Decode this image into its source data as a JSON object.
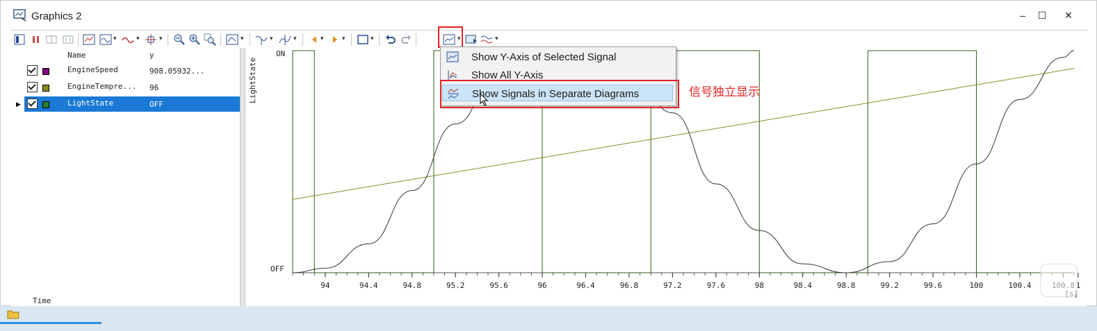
{
  "window": {
    "title": "Graphics 2",
    "min": "–",
    "max": "☐",
    "close": "✕"
  },
  "signals": {
    "headers": {
      "name": "Name",
      "y": "y"
    },
    "rows": [
      {
        "name": "EngineSpeed",
        "value": "908.05932...",
        "color": "#800080"
      },
      {
        "name": "EngineTempre...",
        "value": "96",
        "color": "#8a8a20"
      },
      {
        "name": "LightState",
        "value": "OFF",
        "color": "#2e7d32"
      }
    ],
    "time_label": "Time"
  },
  "menu": {
    "items": [
      {
        "label": "Show Y-Axis of Selected Signal"
      },
      {
        "label": "Show All Y-Axis"
      },
      {
        "label": "Show Signals in Separate Diagrams"
      }
    ]
  },
  "annotation": {
    "text": "信号独立显示"
  },
  "chart_data": {
    "type": "line",
    "ylabel": "LightState",
    "yticks": [
      "ON",
      "OFF"
    ],
    "xunit": "[s]",
    "xlim": [
      93.7,
      100.9
    ],
    "xticks": [
      "94",
      "94.4",
      "94.8",
      "95.2",
      "95.6",
      "96",
      "96.4",
      "96.8",
      "97.2",
      "97.6",
      "98",
      "98.4",
      "98.8",
      "99.2",
      "99.6",
      "100",
      "100.4",
      "100.8",
      "1"
    ],
    "series": [
      {
        "name": "LightState",
        "color": "#2e5e12",
        "x": [
          93.7,
          93.7,
          93.9,
          93.9,
          95.0,
          95.0,
          96.0,
          96.0,
          97.0,
          97.0,
          98.0,
          98.0,
          99.0,
          99.0,
          100.0,
          100.0,
          100.9
        ],
        "y": [
          0,
          1,
          1,
          0,
          0,
          1,
          1,
          0,
          0,
          1,
          1,
          0,
          0,
          1,
          1,
          0,
          0
        ]
      },
      {
        "name": "EngineTempre...",
        "color": "#8a8a20",
        "x": [
          93.7,
          100.9
        ],
        "y": [
          0.33,
          0.92
        ]
      },
      {
        "name": "EngineSpeed",
        "color": "#333333",
        "x": [
          93.7,
          94.0,
          94.4,
          94.8,
          95.2,
          95.6,
          96.0,
          96.4,
          96.8,
          97.2,
          97.6,
          98.0,
          98.4,
          98.8,
          99.2,
          99.6,
          100.0,
          100.4,
          100.8,
          100.9
        ],
        "y": [
          0.0,
          0.02,
          0.13,
          0.37,
          0.67,
          0.91,
          1.0,
          0.91,
          0.92,
          0.72,
          0.4,
          0.19,
          0.04,
          0.0,
          0.05,
          0.22,
          0.49,
          0.78,
          0.97,
          1.0
        ]
      }
    ]
  }
}
